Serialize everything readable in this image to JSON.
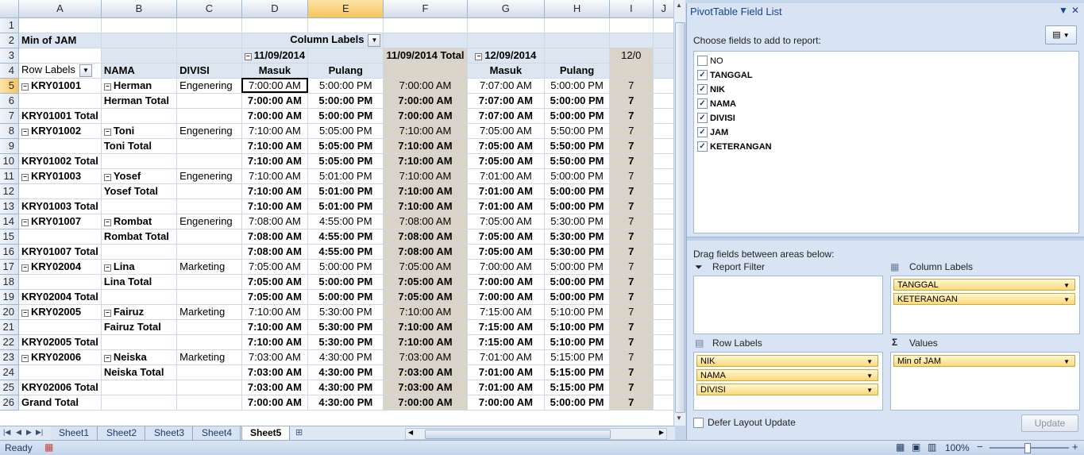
{
  "columns": [
    "A",
    "B",
    "C",
    "D",
    "E",
    "F",
    "G",
    "H",
    "I",
    "J"
  ],
  "rows": [
    {
      "n": "1",
      "cells": [
        "",
        "",
        "",
        "",
        "",
        "",
        "",
        "",
        "",
        "",
        ""
      ]
    },
    {
      "n": "2",
      "cells": [
        "",
        "Min of JAM",
        "",
        "",
        "Column Labels",
        "",
        "",
        "",
        "",
        "",
        ""
      ]
    },
    {
      "n": "3",
      "cells": [
        "",
        "",
        "",
        "",
        "11/09/2014",
        "",
        "11/09/2014 Total",
        "12/09/2014",
        "",
        "12/0"
      ]
    },
    {
      "n": "4",
      "cells": [
        "",
        "Row Labels",
        "NAMA",
        "DIVISI",
        "Masuk",
        "Pulang",
        "",
        "Masuk",
        "Pulang",
        ""
      ]
    },
    {
      "n": "5",
      "cells": [
        "",
        "KRY01001",
        "Herman",
        "Engenering",
        "7:00:00 AM",
        "5:00:00 PM",
        "7:00:00 AM",
        "7:07:00 AM",
        "5:00:00 PM",
        "7"
      ]
    },
    {
      "n": "6",
      "cells": [
        "",
        "",
        "Herman Total",
        "",
        "7:00:00 AM",
        "5:00:00 PM",
        "7:00:00 AM",
        "7:07:00 AM",
        "5:00:00 PM",
        "7"
      ]
    },
    {
      "n": "7",
      "cells": [
        "",
        "KRY01001 Total",
        "",
        "",
        "7:00:00 AM",
        "5:00:00 PM",
        "7:00:00 AM",
        "7:07:00 AM",
        "5:00:00 PM",
        "7"
      ]
    },
    {
      "n": "8",
      "cells": [
        "",
        "KRY01002",
        "Toni",
        "Engenering",
        "7:10:00 AM",
        "5:05:00 PM",
        "7:10:00 AM",
        "7:05:00 AM",
        "5:50:00 PM",
        "7"
      ]
    },
    {
      "n": "9",
      "cells": [
        "",
        "",
        "Toni Total",
        "",
        "7:10:00 AM",
        "5:05:00 PM",
        "7:10:00 AM",
        "7:05:00 AM",
        "5:50:00 PM",
        "7"
      ]
    },
    {
      "n": "10",
      "cells": [
        "",
        "KRY01002 Total",
        "",
        "",
        "7:10:00 AM",
        "5:05:00 PM",
        "7:10:00 AM",
        "7:05:00 AM",
        "5:50:00 PM",
        "7"
      ]
    },
    {
      "n": "11",
      "cells": [
        "",
        "KRY01003",
        "Yosef",
        "Engenering",
        "7:10:00 AM",
        "5:01:00 PM",
        "7:10:00 AM",
        "7:01:00 AM",
        "5:00:00 PM",
        "7"
      ]
    },
    {
      "n": "12",
      "cells": [
        "",
        "",
        "Yosef Total",
        "",
        "7:10:00 AM",
        "5:01:00 PM",
        "7:10:00 AM",
        "7:01:00 AM",
        "5:00:00 PM",
        "7"
      ]
    },
    {
      "n": "13",
      "cells": [
        "",
        "KRY01003 Total",
        "",
        "",
        "7:10:00 AM",
        "5:01:00 PM",
        "7:10:00 AM",
        "7:01:00 AM",
        "5:00:00 PM",
        "7"
      ]
    },
    {
      "n": "14",
      "cells": [
        "",
        "KRY01007",
        "Rombat",
        "Engenering",
        "7:08:00 AM",
        "4:55:00 PM",
        "7:08:00 AM",
        "7:05:00 AM",
        "5:30:00 PM",
        "7"
      ]
    },
    {
      "n": "15",
      "cells": [
        "",
        "",
        "Rombat Total",
        "",
        "7:08:00 AM",
        "4:55:00 PM",
        "7:08:00 AM",
        "7:05:00 AM",
        "5:30:00 PM",
        "7"
      ]
    },
    {
      "n": "16",
      "cells": [
        "",
        "KRY01007 Total",
        "",
        "",
        "7:08:00 AM",
        "4:55:00 PM",
        "7:08:00 AM",
        "7:05:00 AM",
        "5:30:00 PM",
        "7"
      ]
    },
    {
      "n": "17",
      "cells": [
        "",
        "KRY02004",
        "Lina",
        "Marketing",
        "7:05:00 AM",
        "5:00:00 PM",
        "7:05:00 AM",
        "7:00:00 AM",
        "5:00:00 PM",
        "7"
      ]
    },
    {
      "n": "18",
      "cells": [
        "",
        "",
        "Lina Total",
        "",
        "7:05:00 AM",
        "5:00:00 PM",
        "7:05:00 AM",
        "7:00:00 AM",
        "5:00:00 PM",
        "7"
      ]
    },
    {
      "n": "19",
      "cells": [
        "",
        "KRY02004 Total",
        "",
        "",
        "7:05:00 AM",
        "5:00:00 PM",
        "7:05:00 AM",
        "7:00:00 AM",
        "5:00:00 PM",
        "7"
      ]
    },
    {
      "n": "20",
      "cells": [
        "",
        "KRY02005",
        "Fairuz",
        "Marketing",
        "7:10:00 AM",
        "5:30:00 PM",
        "7:10:00 AM",
        "7:15:00 AM",
        "5:10:00 PM",
        "7"
      ]
    },
    {
      "n": "21",
      "cells": [
        "",
        "",
        "Fairuz Total",
        "",
        "7:10:00 AM",
        "5:30:00 PM",
        "7:10:00 AM",
        "7:15:00 AM",
        "5:10:00 PM",
        "7"
      ]
    },
    {
      "n": "22",
      "cells": [
        "",
        "KRY02005 Total",
        "",
        "",
        "7:10:00 AM",
        "5:30:00 PM",
        "7:10:00 AM",
        "7:15:00 AM",
        "5:10:00 PM",
        "7"
      ]
    },
    {
      "n": "23",
      "cells": [
        "",
        "KRY02006",
        "Neiska",
        "Marketing",
        "7:03:00 AM",
        "4:30:00 PM",
        "7:03:00 AM",
        "7:01:00 AM",
        "5:15:00 PM",
        "7"
      ]
    },
    {
      "n": "24",
      "cells": [
        "",
        "",
        "Neiska Total",
        "",
        "7:03:00 AM",
        "4:30:00 PM",
        "7:03:00 AM",
        "7:01:00 AM",
        "5:15:00 PM",
        "7"
      ]
    },
    {
      "n": "25",
      "cells": [
        "",
        "KRY02006 Total",
        "",
        "",
        "7:03:00 AM",
        "4:30:00 PM",
        "7:03:00 AM",
        "7:01:00 AM",
        "5:15:00 PM",
        "7"
      ]
    },
    {
      "n": "26",
      "cells": [
        "",
        "Grand Total",
        "",
        "",
        "7:00:00 AM",
        "4:30:00 PM",
        "7:00:00 AM",
        "7:00:00 AM",
        "5:00:00 PM",
        "7"
      ]
    }
  ],
  "sheet_tabs": [
    "Sheet1",
    "Sheet2",
    "Sheet3",
    "Sheet4",
    "Sheet5"
  ],
  "active_tab": "Sheet5",
  "status": {
    "ready": "Ready",
    "zoom": "100%",
    "zoom_minus": "−",
    "zoom_plus": "+"
  },
  "pane": {
    "title": "PivotTable Field List",
    "choose_label": "Choose fields to add to report:",
    "fields": [
      {
        "name": "NO",
        "checked": false
      },
      {
        "name": "TANGGAL",
        "checked": true
      },
      {
        "name": "NIK",
        "checked": true
      },
      {
        "name": "NAMA",
        "checked": true
      },
      {
        "name": "DIVISI",
        "checked": true
      },
      {
        "name": "JAM",
        "checked": true
      },
      {
        "name": "KETERANGAN",
        "checked": true
      }
    ],
    "drag_label": "Drag fields between areas below:",
    "report_filter": "Report Filter",
    "column_labels": "Column Labels",
    "row_labels": "Row Labels",
    "values": "Values",
    "column_items": [
      "TANGGAL",
      "KETERANGAN"
    ],
    "row_items": [
      "NIK",
      "NAMA",
      "DIVISI"
    ],
    "value_items": [
      "Min of JAM"
    ],
    "defer": "Defer Layout Update",
    "update": "Update"
  },
  "icons": {
    "checkmark": "✓",
    "dropdown": "▼",
    "minus": "−"
  }
}
